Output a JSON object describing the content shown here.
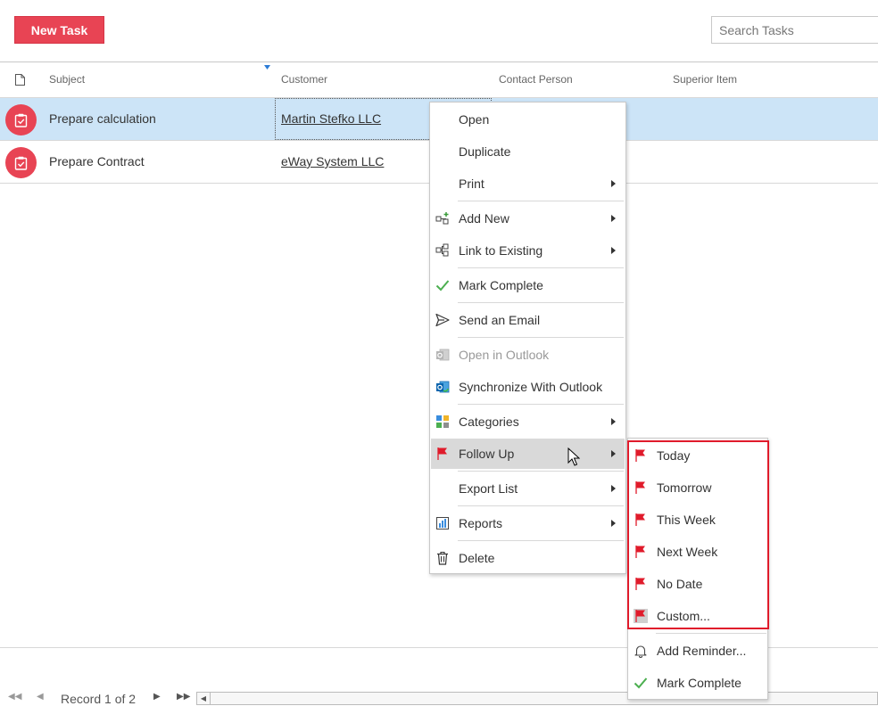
{
  "toolbar": {
    "new_task_label": "New Task",
    "search_placeholder": "Search Tasks"
  },
  "grid": {
    "columns": [
      "Subject",
      "Customer",
      "Contact Person",
      "Superior Item"
    ],
    "rows": [
      {
        "subject": "Prepare calculation",
        "customer": "Martin Stefko LLC",
        "selected": true
      },
      {
        "subject": "Prepare Contract",
        "customer": "eWay System LLC",
        "selected": false
      }
    ]
  },
  "context_menu": {
    "items": [
      {
        "label": "Open",
        "icon": "none"
      },
      {
        "label": "Duplicate",
        "icon": "none"
      },
      {
        "label": "Print",
        "icon": "none",
        "submenu": true
      },
      {
        "label": "Add New",
        "icon": "add-new-icon",
        "submenu": true
      },
      {
        "label": "Link to Existing",
        "icon": "link-icon",
        "submenu": true
      },
      {
        "label": "Mark Complete",
        "icon": "checkmark-icon"
      },
      {
        "label": "Send an Email",
        "icon": "send-icon"
      },
      {
        "label": "Open in Outlook",
        "icon": "outlook-icon",
        "disabled": true
      },
      {
        "label": "Synchronize With Outlook",
        "icon": "outlook-sync-icon"
      },
      {
        "label": "Categories",
        "icon": "categories-icon",
        "submenu": true
      },
      {
        "label": "Follow Up",
        "icon": "flag-icon",
        "submenu": true,
        "hover": true
      },
      {
        "label": "Export List",
        "icon": "none",
        "submenu": true
      },
      {
        "label": "Reports",
        "icon": "reports-icon",
        "submenu": true
      },
      {
        "label": "Delete",
        "icon": "trash-icon"
      }
    ]
  },
  "follow_up_menu": {
    "items": [
      {
        "label": "Today",
        "icon": "flag-icon"
      },
      {
        "label": "Tomorrow",
        "icon": "flag-icon"
      },
      {
        "label": "This Week",
        "icon": "flag-icon"
      },
      {
        "label": "Next Week",
        "icon": "flag-icon"
      },
      {
        "label": "No Date",
        "icon": "flag-icon"
      },
      {
        "label": "Custom...",
        "icon": "flag-custom-icon"
      },
      {
        "label": "Add Reminder...",
        "icon": "bell-icon"
      },
      {
        "label": "Mark Complete",
        "icon": "checkmark-icon"
      }
    ]
  },
  "pager": {
    "record_text": "Record 1 of 2"
  },
  "colors": {
    "accent": "#e84454",
    "selection": "#cce4f7",
    "flag_red": "#e01b2b",
    "check_green": "#4caf50"
  }
}
